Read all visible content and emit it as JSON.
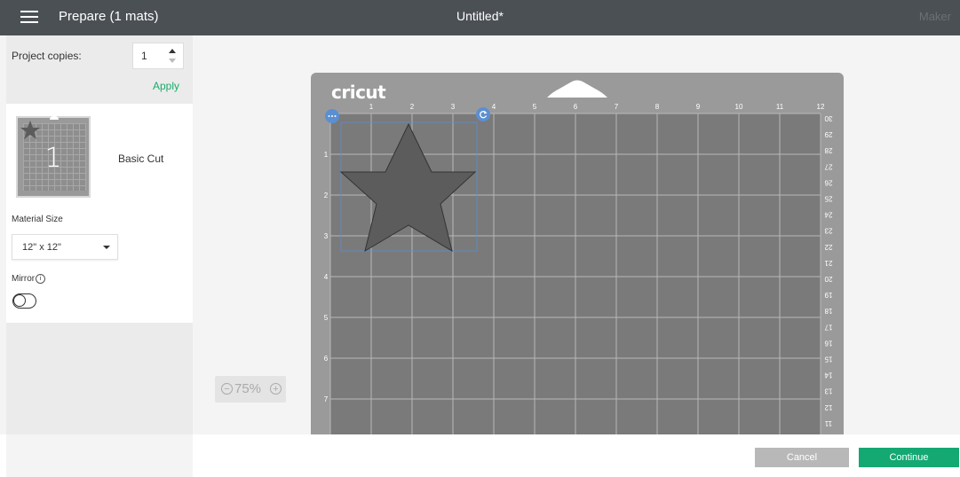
{
  "header": {
    "menu_icon": "hamburger-menu-icon",
    "title": "Prepare (1 mats)",
    "document_title": "Untitled*",
    "machine": "Maker"
  },
  "sidebar": {
    "copies_label": "Project copies:",
    "copies_value": "1",
    "apply_label": "Apply",
    "mats": [
      {
        "number": "1",
        "name": "Basic Cut"
      }
    ],
    "material_size_label": "Material Size",
    "material_size_value": "12\" x 12\"",
    "mirror_label": "Mirror",
    "mirror_on": false
  },
  "canvas": {
    "mat_logo": "cricut",
    "top_ruler": [
      "1",
      "2",
      "3",
      "4",
      "5",
      "6",
      "7",
      "8",
      "9",
      "10",
      "11",
      "12"
    ],
    "left_ruler": [
      "1",
      "2",
      "3",
      "4",
      "5",
      "6",
      "7"
    ],
    "right_ruler": [
      "30",
      "29",
      "28",
      "27",
      "26",
      "25",
      "24",
      "23",
      "22",
      "21",
      "20",
      "19",
      "18",
      "17",
      "16",
      "15",
      "14",
      "13",
      "12",
      "11"
    ],
    "zoom_value": "75%",
    "shape": "star",
    "shape_color": "#5c5c5c",
    "selection_color": "#4a7fc1"
  },
  "footer": {
    "cancel_label": "Cancel",
    "continue_label": "Continue"
  },
  "colors": {
    "accent": "#14a873",
    "topbar": "#4b5055",
    "mat": "#9a9a9a",
    "mat_grid": "#7a7a7a"
  }
}
